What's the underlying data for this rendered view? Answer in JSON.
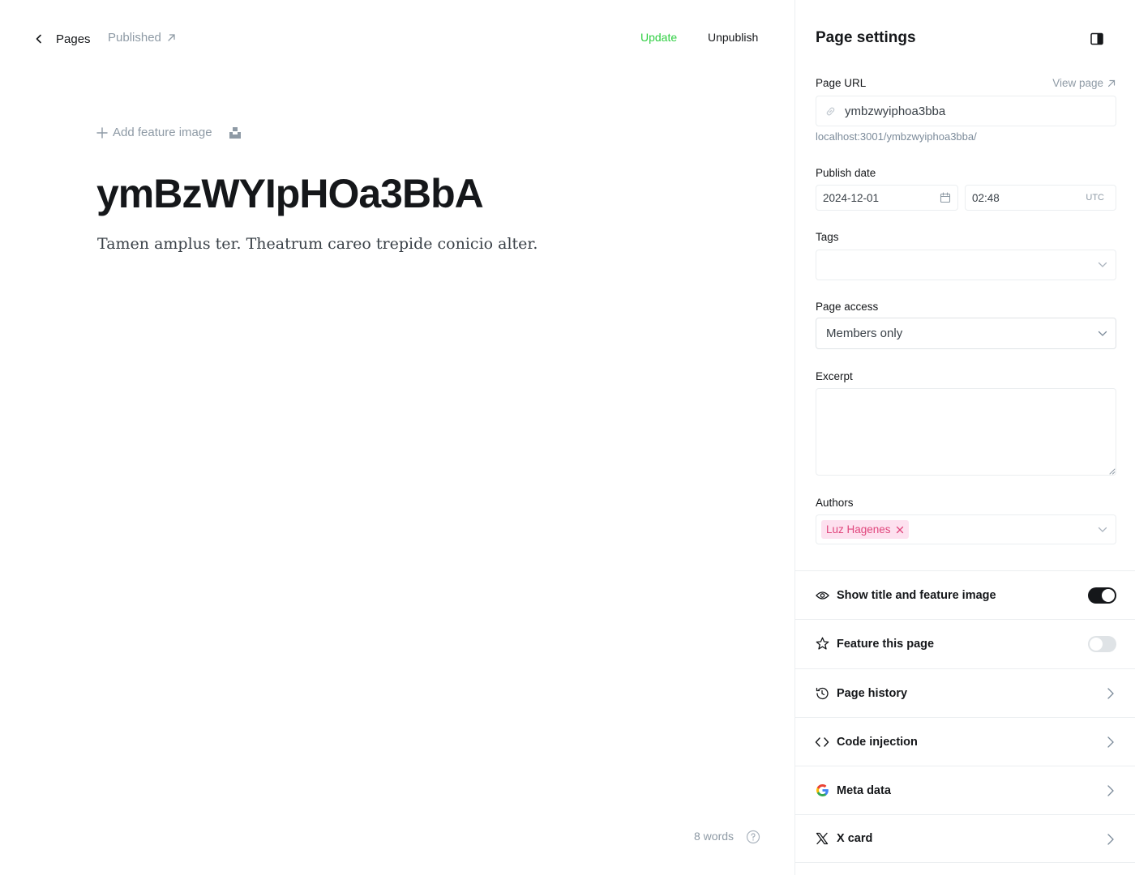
{
  "header": {
    "back_label": "Pages",
    "status_label": "Published",
    "update_label": "Update",
    "unpublish_label": "Unpublish"
  },
  "editor": {
    "add_feature_image_label": "Add feature image",
    "title": "ymBzWYIpHOa3BbA",
    "body": "Tamen amplus ter. Theatrum careo trepide conicio alter.",
    "word_count": "8 words"
  },
  "settings": {
    "title": "Page settings",
    "page_url_label": "Page URL",
    "view_page_label": "View page",
    "slug": "ymbzwyiphoa3bba",
    "url_hint": "localhost:3001/ymbzwyiphoa3bba/",
    "publish_date_label": "Publish date",
    "date": "2024-12-01",
    "time": "02:48",
    "timezone": "UTC",
    "tags_label": "Tags",
    "page_access_label": "Page access",
    "page_access_value": "Members only",
    "excerpt_label": "Excerpt",
    "excerpt_value": "",
    "authors_label": "Authors",
    "authors": [
      "Luz Hagenes"
    ],
    "rows": {
      "show_title": "Show title and feature image",
      "feature_page": "Feature this page",
      "page_history": "Page history",
      "code_injection": "Code injection",
      "meta_data": "Meta data",
      "x_card": "X card"
    },
    "show_title_enabled": true,
    "feature_page_enabled": false
  },
  "colors": {
    "accent_green": "#30cf43",
    "author_chip_bg": "#fde1ef",
    "author_chip_text": "#e0467c",
    "toggle_on": "#15171a",
    "toggle_off": "#dfe3e6"
  }
}
